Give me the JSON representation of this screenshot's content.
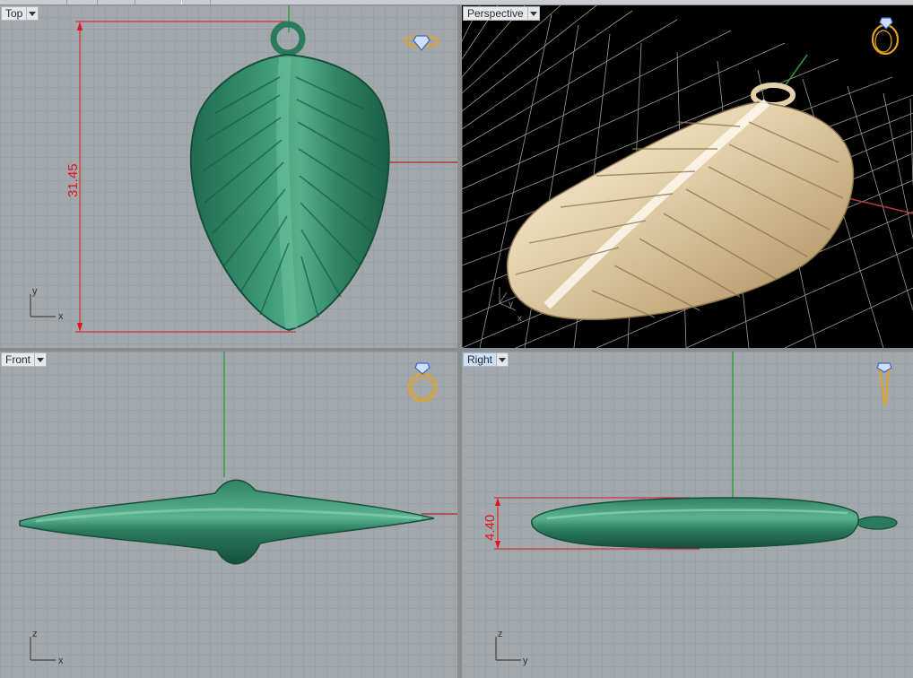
{
  "viewports": {
    "top": {
      "label": "Top",
      "dimension": "31.45",
      "axis_h": "x",
      "axis_v": "y"
    },
    "perspective": {
      "label": "Perspective",
      "axis_h": "x",
      "axis_v": "y"
    },
    "front": {
      "label": "Front",
      "axis_h": "x",
      "axis_v": "z"
    },
    "right": {
      "label": "Right",
      "dimension": "4.40",
      "axis_h": "y",
      "axis_v": "z"
    }
  },
  "icons": {
    "top_view_icon": "ring-top-view-icon",
    "perspective_view_icon": "ring-perspective-icon",
    "front_view_icon": "ring-front-view-icon",
    "right_view_icon": "ring-side-view-icon",
    "dropdown": "chevron-down-icon"
  },
  "colors": {
    "model_green": "#2a7a5e",
    "model_gold": "#e4d2ad",
    "dimension_red": "#e0141e",
    "axis_green": "#2fa03a",
    "icon_gold": "#e8a31c",
    "icon_blue": "#3c66c8"
  }
}
